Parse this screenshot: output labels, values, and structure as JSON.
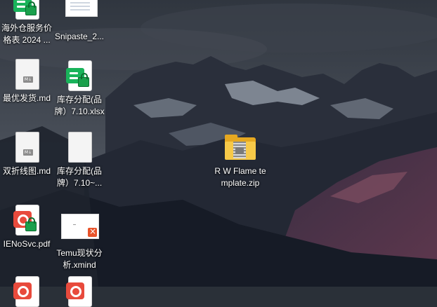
{
  "desktop": {
    "icons": [
      {
        "name": "desktop-icon-overseas-pricing",
        "label": "海外仓服务价格表 2024 ...",
        "icon": "excel-locked-icon"
      },
      {
        "name": "desktop-icon-snipaste",
        "label": "Snipaste_2...",
        "icon": "image-thumbnail-icon"
      },
      {
        "name": "desktop-icon-best-shipping-md",
        "label": "最优发货.md",
        "icon": "markdown-file-icon"
      },
      {
        "name": "desktop-icon-inventory-xlsx",
        "label": "库存分配(品牌）7.10.xlsx",
        "icon": "excel-locked-icon"
      },
      {
        "name": "desktop-icon-double-line-md",
        "label": "双折线图.md",
        "icon": "markdown-file-icon"
      },
      {
        "name": "desktop-icon-inventory-tmp",
        "label": "库存分配(品牌）7.10~...",
        "icon": "blank-file-icon"
      },
      {
        "name": "desktop-icon-flame-zip",
        "label": "R W Flame template.zip",
        "icon": "zip-folder-icon"
      },
      {
        "name": "desktop-icon-ienosvc-pdf",
        "label": "IENoSvc.pdf",
        "icon": "pdf-locked-icon"
      },
      {
        "name": "desktop-icon-temu-xmind",
        "label": "Temu现状分析.xmind",
        "icon": "xmind-file-icon"
      }
    ]
  },
  "colors": {
    "sky_top": "#2f3640",
    "sky_mid": "#4a505a",
    "mountain_dark": "#1c2230",
    "mountain_rose": "#5a3a4e",
    "snow": "#b9c1cc",
    "label_text": "#ffffff"
  }
}
